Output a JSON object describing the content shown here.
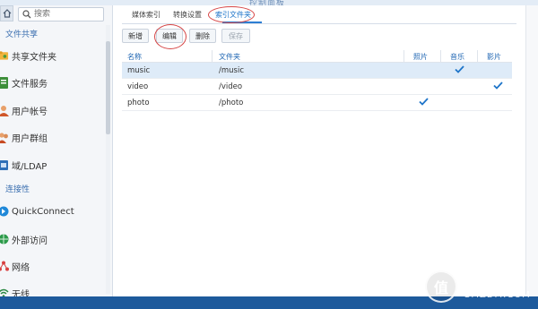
{
  "window": {
    "title": "控制面板"
  },
  "sidebar": {
    "search_placeholder": "搜索",
    "sections": [
      {
        "header": "文件共享",
        "items": [
          {
            "label": "共享文件夹",
            "icon": "shared-folder-icon"
          },
          {
            "label": "文件服务",
            "icon": "file-services-icon"
          },
          {
            "label": "用户帐号",
            "icon": "user-icon"
          },
          {
            "label": "用户群组",
            "icon": "group-icon"
          },
          {
            "label": "域/LDAP",
            "icon": "domain-icon"
          }
        ]
      },
      {
        "header": "连接性",
        "items": [
          {
            "label": "QuickConnect",
            "icon": "quickconnect-icon"
          },
          {
            "label": "外部访问",
            "icon": "globe-icon"
          },
          {
            "label": "网络",
            "icon": "network-icon"
          },
          {
            "label": "无线",
            "icon": "wifi-icon"
          }
        ]
      }
    ]
  },
  "tabs": [
    {
      "label": "媒体索引"
    },
    {
      "label": "转换设置"
    },
    {
      "label": "索引文件夹",
      "active": true
    }
  ],
  "toolbar": {
    "add": "新增",
    "edit": "编辑",
    "delete": "删除",
    "save": "保存"
  },
  "table": {
    "columns": [
      "名称",
      "文件夹",
      "照片",
      "音乐",
      "影片"
    ],
    "rows": [
      {
        "name": "music",
        "folder": "/music",
        "photo": false,
        "music": true,
        "video": false
      },
      {
        "name": "video",
        "folder": "/video",
        "photo": false,
        "music": false,
        "video": true
      },
      {
        "name": "photo",
        "folder": "/photo",
        "photo": true,
        "music": false,
        "video": false
      }
    ]
  },
  "watermark": {
    "line1": "什么值得买",
    "line2": "SMZDM.COM",
    "logo_glyph": "值"
  },
  "colors": {
    "accent": "#1d74c9",
    "selected_row": "#deebf8",
    "annotation": "#d64545"
  }
}
